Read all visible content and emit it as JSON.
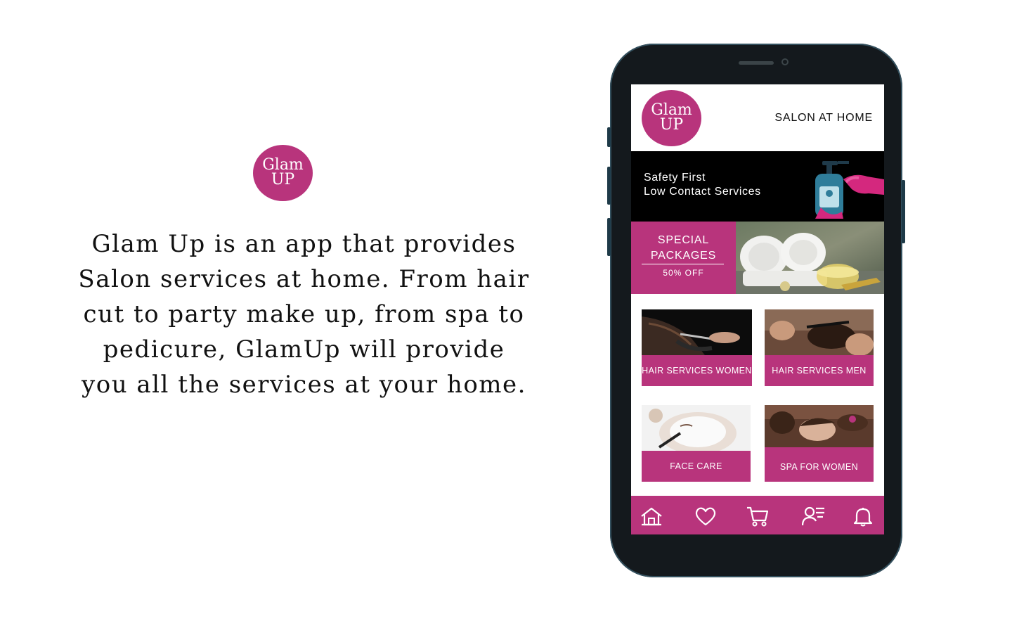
{
  "brand": {
    "line1": "Glam",
    "line2": "UP"
  },
  "description": "Glam Up is an app that provides Salon services at home. From hair cut to party make up, from spa to pedicure, GlamUp will provide you all the services at your home.",
  "app": {
    "tagline": "SALON AT HOME",
    "banner": {
      "line1": "Safety First",
      "line2": "Low Contact Services"
    },
    "special": {
      "title_line1": "SPECIAL",
      "title_line2": "PACKAGES",
      "offer": "50% OFF"
    },
    "services": [
      {
        "label": "HAIR SERVICES WOMEN"
      },
      {
        "label": "HAIR SERVICES MEN"
      },
      {
        "label": "FACE CARE"
      },
      {
        "label": "SPA FOR WOMEN"
      }
    ],
    "nav": [
      "home-icon",
      "heart-icon",
      "cart-icon",
      "profile-list-icon",
      "bell-icon"
    ]
  },
  "colors": {
    "brand": "#b8347c",
    "phone_body": "#14191d",
    "banner_bg": "#000000"
  }
}
